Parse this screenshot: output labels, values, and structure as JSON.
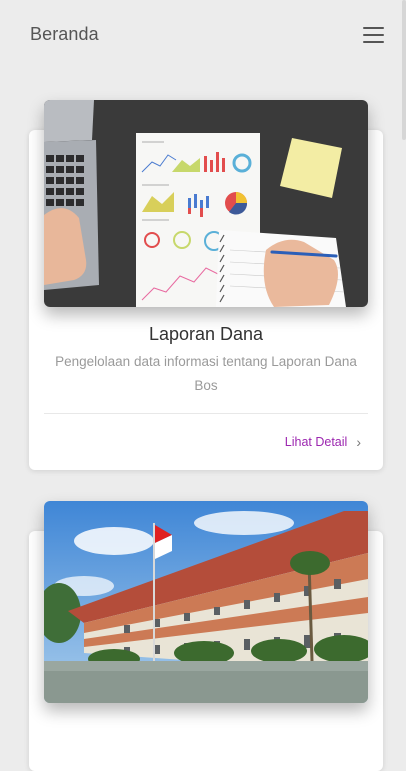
{
  "header": {
    "title": "Beranda",
    "menu_icon": "hamburger-menu-icon"
  },
  "cards": [
    {
      "image": "financial-report-charts-photo",
      "title": "Laporan Dana",
      "description": "Pengelolaan data informasi tentang Laporan Dana Bos",
      "link_label": "Lihat Detail",
      "link_icon": "chevron-right-icon"
    },
    {
      "image": "school-building-photo"
    }
  ],
  "colors": {
    "background": "#ececec",
    "card": "#ffffff",
    "link": "#9c27b0"
  }
}
